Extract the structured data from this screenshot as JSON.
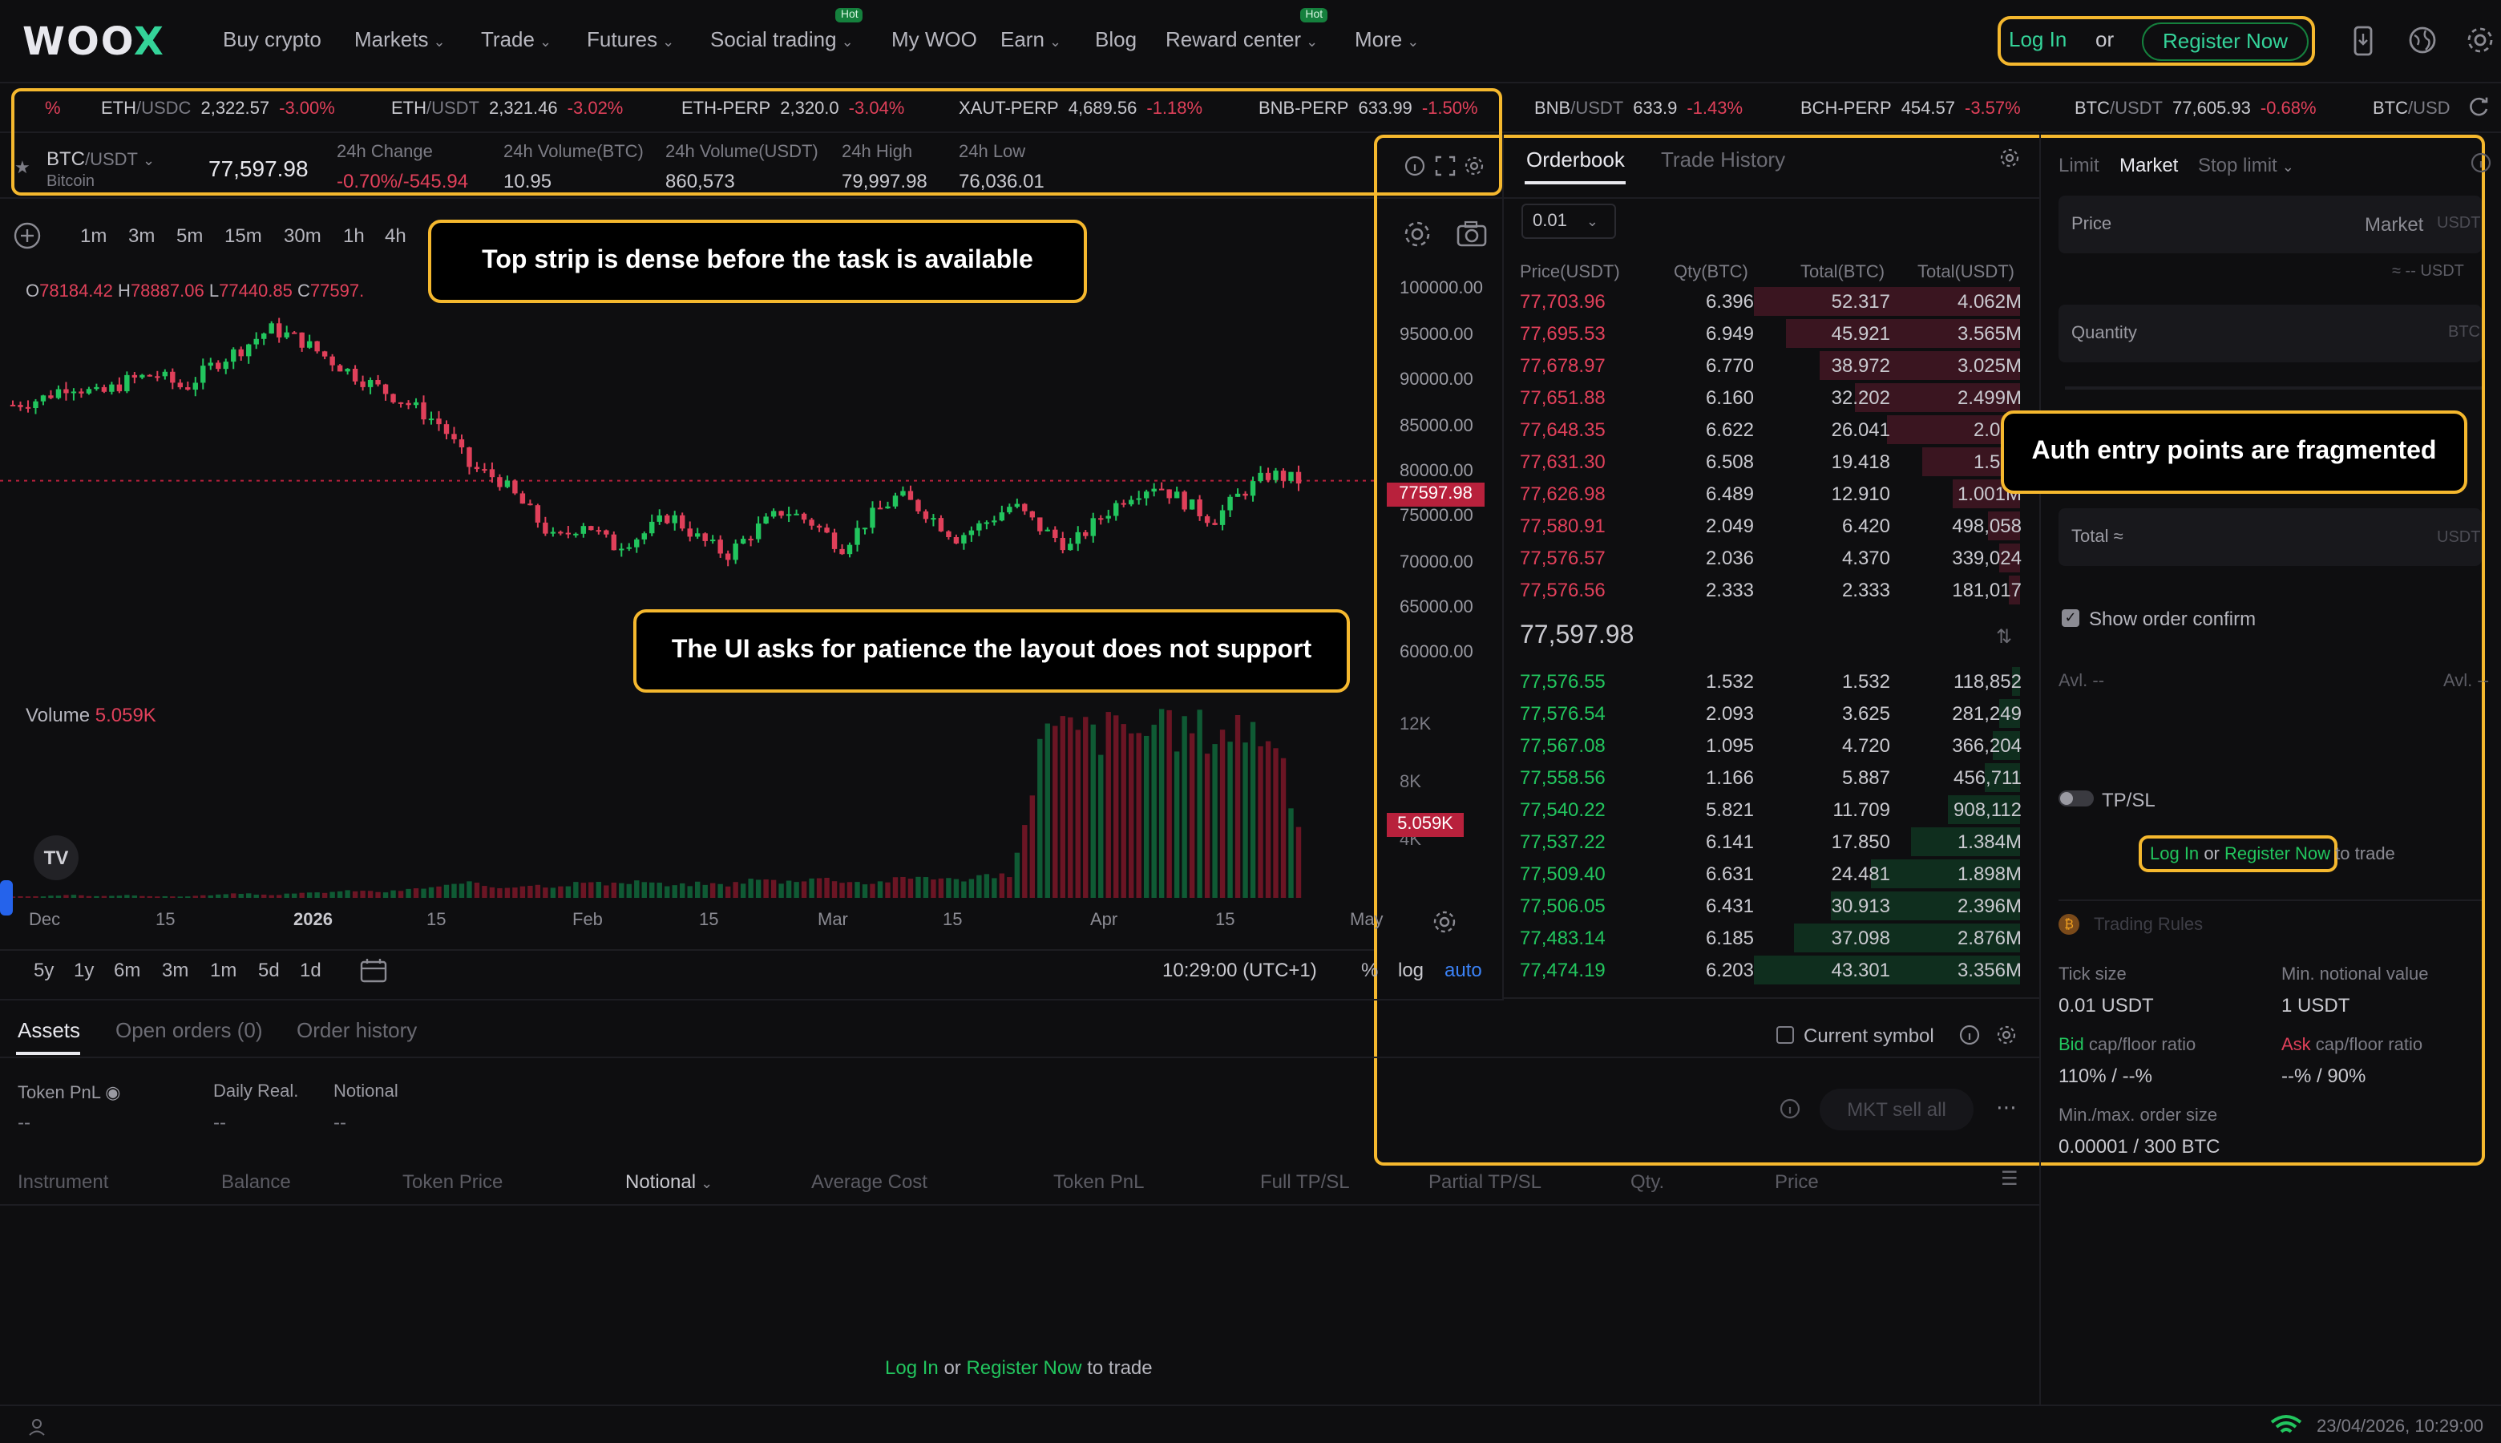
{
  "brand": {
    "logo_text": "WOO",
    "logo_accent": "X"
  },
  "nav": {
    "items": [
      "Buy crypto",
      "Markets",
      "Trade",
      "Futures",
      "Social trading",
      "My WOO",
      "Earn",
      "Blog",
      "Reward center",
      "More"
    ],
    "hot_badge": "Hot",
    "login": "Log In",
    "or": "or",
    "register": "Register Now"
  },
  "ticker": [
    {
      "symbol": "%",
      "quote": "",
      "price": "",
      "change": ""
    },
    {
      "symbol": "ETH",
      "quote": "/USDC",
      "price": "2,322.57",
      "change": "-3.00%"
    },
    {
      "symbol": "ETH",
      "quote": "/USDT",
      "price": "2,321.46",
      "change": "-3.02%"
    },
    {
      "symbol": "ETH-PERP",
      "quote": "",
      "price": "2,320.0",
      "change": "-3.04%"
    },
    {
      "symbol": "XAUT-PERP",
      "quote": "",
      "price": "4,689.56",
      "change": "-1.18%"
    },
    {
      "symbol": "BNB-PERP",
      "quote": "",
      "price": "633.99",
      "change": "-1.50%"
    },
    {
      "symbol": "BNB",
      "quote": "/USDT",
      "price": "633.9",
      "change": "-1.43%"
    },
    {
      "symbol": "BCH-PERP",
      "quote": "",
      "price": "454.57",
      "change": "-3.57%"
    },
    {
      "symbol": "BTC",
      "quote": "/USDT",
      "price": "77,605.93",
      "change": "-0.68%"
    },
    {
      "symbol": "BTC",
      "quote": "/USD",
      "price": "",
      "change": ""
    }
  ],
  "market": {
    "pair": "BTC",
    "pair_quote": "/USDT",
    "pair_name": "Bitcoin",
    "last_price": "77,597.98",
    "stats": [
      {
        "label": "24h Change",
        "value": "-0.70%/-545.94"
      },
      {
        "label": "24h Volume(BTC)",
        "value": "10.95"
      },
      {
        "label": "24h Volume(USDT)",
        "value": "860,573"
      },
      {
        "label": "24h High",
        "value": "79,997.98"
      },
      {
        "label": "24h Low",
        "value": "76,036.01"
      }
    ]
  },
  "chart_toolbar": {
    "timeframes": [
      "1m",
      "3m",
      "5m",
      "15m",
      "30m",
      "1h",
      "4h"
    ]
  },
  "ohlc": {
    "o": "78184.42",
    "h": "78887.06",
    "l": "77440.85",
    "c": "77597."
  },
  "callouts": {
    "top_strip": "Top strip is dense before the task is available",
    "patience": "The UI asks for patience the layout does not support",
    "auth": "Auth entry points are fragmented"
  },
  "price_axis": [
    "100000.00",
    "95000.00",
    "90000.00",
    "85000.00",
    "80000.00",
    "75000.00",
    "70000.00",
    "65000.00",
    "60000.00"
  ],
  "price_tag": "77597.98",
  "volume": {
    "label": "Volume",
    "value": "5.059K",
    "axis": [
      "12K",
      "8K",
      "4K"
    ],
    "tag": "5.059K"
  },
  "time_axis": [
    "Dec",
    "15",
    "2026",
    "15",
    "Feb",
    "15",
    "Mar",
    "15",
    "Apr",
    "15",
    "May"
  ],
  "range_buttons": [
    "5y",
    "1y",
    "6m",
    "3m",
    "1m",
    "5d",
    "1d"
  ],
  "clock": "10:29:00 (UTC+1)",
  "scale_opts": {
    "pct": "%",
    "log": "log",
    "auto": "auto"
  },
  "chart_data": {
    "type": "candlestick",
    "series": [
      {
        "name": "BTC/USDT",
        "values": [
          86500,
          87200,
          88900,
          87600,
          89300,
          90100,
          88400,
          91200,
          93100,
          95400,
          94200,
          92000,
          89900,
          88100,
          86300,
          84100,
          79200,
          77800,
          74300,
          70500,
          72800,
          69900,
          71200,
          73600,
          70800,
          68900,
          71900,
          74200,
          72600,
          69800,
          73300,
          75900,
          73800,
          70900,
          72600,
          74800,
          71900,
          69800,
          73100,
          75900,
          77200,
          75100,
          72900,
          76200,
          78400,
          77598
        ]
      }
    ],
    "ylim": [
      55000,
      102000
    ],
    "volume": {
      "values": [
        0.1,
        0.1,
        0.2,
        0.1,
        0.2,
        0.1,
        0.1,
        0.2,
        0.3,
        0.2,
        0.3,
        0.4,
        0.5,
        0.4,
        0.6,
        0.8,
        1.0,
        0.7,
        0.9,
        0.8,
        1.1,
        0.9,
        1.2,
        0.8,
        1.0,
        0.9,
        1.3,
        1.1,
        1.4,
        1.2,
        1.0,
        1.3,
        1.5,
        1.2,
        1.6,
        1.4,
        11.2,
        11.6,
        11.4,
        11.8,
        11.3,
        11.7,
        11.5,
        11.9,
        11.4,
        5.059
      ],
      "ylim": [
        0,
        13
      ]
    }
  },
  "orderbook": {
    "tabs": [
      "Orderbook",
      "Trade History"
    ],
    "precision": "0.01",
    "headers": [
      "Price(USDT)",
      "Qty(BTC)",
      "Total(BTC)",
      "Total(USDT)"
    ],
    "asks": [
      [
        "77,703.96",
        "6.396",
        "52.317",
        "4.062M",
        1.0
      ],
      [
        "77,695.53",
        "6.949",
        "45.921",
        "3.565M",
        0.88
      ],
      [
        "77,678.97",
        "6.770",
        "38.972",
        "3.025M",
        0.75
      ],
      [
        "77,651.88",
        "6.160",
        "32.202",
        "2.499M",
        0.62
      ],
      [
        "77,648.35",
        "6.622",
        "26.041",
        "2.021",
        0.5
      ],
      [
        "77,631.30",
        "6.508",
        "19.418",
        "1.507",
        0.37
      ],
      [
        "77,626.98",
        "6.489",
        "12.910",
        "1.001M",
        0.25
      ],
      [
        "77,580.91",
        "2.049",
        "6.420",
        "498,058",
        0.12
      ],
      [
        "77,576.57",
        "2.036",
        "4.370",
        "339,024",
        0.08
      ],
      [
        "77,576.56",
        "2.333",
        "2.333",
        "181,017",
        0.04
      ]
    ],
    "mid": "77,597.98",
    "bids": [
      [
        "77,576.55",
        "1.532",
        "1.532",
        "118,852",
        0.03
      ],
      [
        "77,576.54",
        "2.093",
        "3.625",
        "281,249",
        0.08
      ],
      [
        "77,567.08",
        "1.095",
        "4.720",
        "366,204",
        0.1
      ],
      [
        "77,558.56",
        "1.166",
        "5.887",
        "456,711",
        0.13
      ],
      [
        "77,540.22",
        "5.821",
        "11.709",
        "908,112",
        0.27
      ],
      [
        "77,537.22",
        "6.141",
        "17.850",
        "1.384M",
        0.41
      ],
      [
        "77,509.40",
        "6.631",
        "24.481",
        "1.898M",
        0.56
      ],
      [
        "77,506.05",
        "6.431",
        "30.913",
        "2.396M",
        0.71
      ],
      [
        "77,483.14",
        "6.185",
        "37.098",
        "2.876M",
        0.85
      ],
      [
        "77,474.19",
        "6.203",
        "43.301",
        "3.356M",
        1.0
      ]
    ]
  },
  "order_form": {
    "tabs": [
      "Limit",
      "Market",
      "Stop limit"
    ],
    "price_label": "Price",
    "price_value": "Market",
    "price_unit": "USDT",
    "approx": "≈ -- USDT",
    "qty_label": "Quantity",
    "qty_unit": "BTC",
    "total_label": "Total ≈",
    "total_unit": "USDT",
    "show_confirm": "Show order confirm",
    "avl_left": "Avl. --",
    "avl_right": "Avl. --",
    "tpsl": "TP/SL",
    "login": "Log In",
    "or": "or",
    "register": "Register Now",
    "to_trade": "to trade"
  },
  "trading_rules": {
    "title": "Trading Rules",
    "items": [
      {
        "label": "Tick size",
        "value": "0.01 USDT"
      },
      {
        "label": "Min. notional value",
        "value": "1 USDT"
      },
      {
        "label_prefix": "Bid",
        "label": " cap/floor ratio",
        "value": "110% / --%"
      },
      {
        "label_prefix": "Ask",
        "label": " cap/floor ratio",
        "value": "--% / 90%"
      },
      {
        "label": "Min./max. order size",
        "value": "0.00001 / 300 BTC"
      }
    ]
  },
  "orderbook_footer": {
    "current_symbol": "Current symbol",
    "mkt_sell_all": "MKT sell all"
  },
  "bottom": {
    "tabs": [
      "Assets",
      "Open orders (0)",
      "Order history"
    ],
    "summary": [
      {
        "label": "Token PnL",
        "value": "--"
      },
      {
        "label": "Daily Real.",
        "value": "--"
      },
      {
        "label": "Notional",
        "value": "--"
      }
    ],
    "columns": [
      "Instrument",
      "Balance",
      "Token Price",
      "Notional",
      "Average Cost",
      "Token PnL",
      "Full TP/SL",
      "Partial TP/SL",
      "Qty.",
      "Price"
    ],
    "login": "Log In",
    "or": "or",
    "register": "Register Now",
    "to_trade": "to trade"
  },
  "status": {
    "datetime": "23/04/2026, 10:29:00"
  },
  "colors": {
    "accent_green": "#34d399",
    "down_red": "#e0405a",
    "highlight": "#f5b82e",
    "bg": "#0e0e10"
  }
}
